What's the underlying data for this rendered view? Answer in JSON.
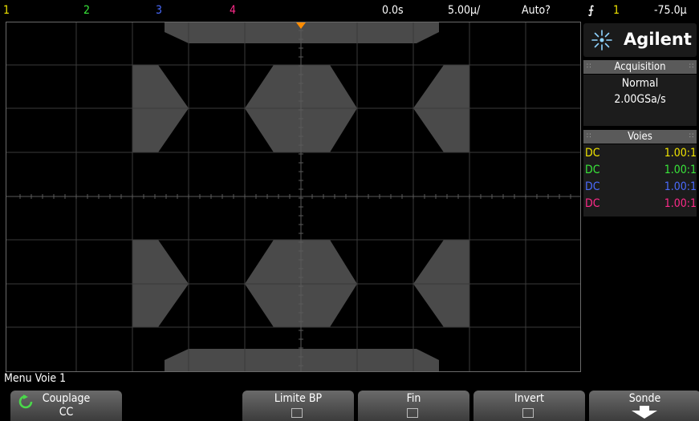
{
  "status_bar": {
    "ch1": "1",
    "ch2": "2",
    "ch3": "3",
    "ch4": "4",
    "time_offset": "0.0s",
    "timebase": "5.00µ/",
    "trigger_mode": "Auto?",
    "trigger_source": "1",
    "trigger_level": "-75.0µ"
  },
  "colors": {
    "ch1": "#f2e600",
    "ch2": "#39e83a",
    "ch3": "#4a6bff",
    "ch4": "#ff2a8a",
    "mask": "#4a4a4a",
    "grid": "#3a3a3a",
    "trigger_marker": "#ff8c00"
  },
  "brand": {
    "logo_text": "Agilent",
    "logo_icon": "agilent-spark-icon"
  },
  "acquisition": {
    "title": "Acquisition",
    "mode": "Normal",
    "rate": "2.00GSa/s"
  },
  "channels_panel": {
    "title": "Voies",
    "rows": [
      {
        "coupling": "DC",
        "probe": "1.00:1"
      },
      {
        "coupling": "DC",
        "probe": "1.00:1"
      },
      {
        "coupling": "DC",
        "probe": "1.00:1"
      },
      {
        "coupling": "DC",
        "probe": "1.00:1"
      }
    ]
  },
  "menu": {
    "title": "Menu Voie 1",
    "softkeys": [
      {
        "label": "Couplage",
        "value": "CC",
        "icon": "cycle-icon"
      },
      {
        "label": "Limite BP",
        "checked": false
      },
      {
        "label": "Fin",
        "checked": false
      },
      {
        "label": "Invert",
        "checked": false
      },
      {
        "label": "Sonde",
        "icon": "arrow-down-icon"
      }
    ]
  }
}
